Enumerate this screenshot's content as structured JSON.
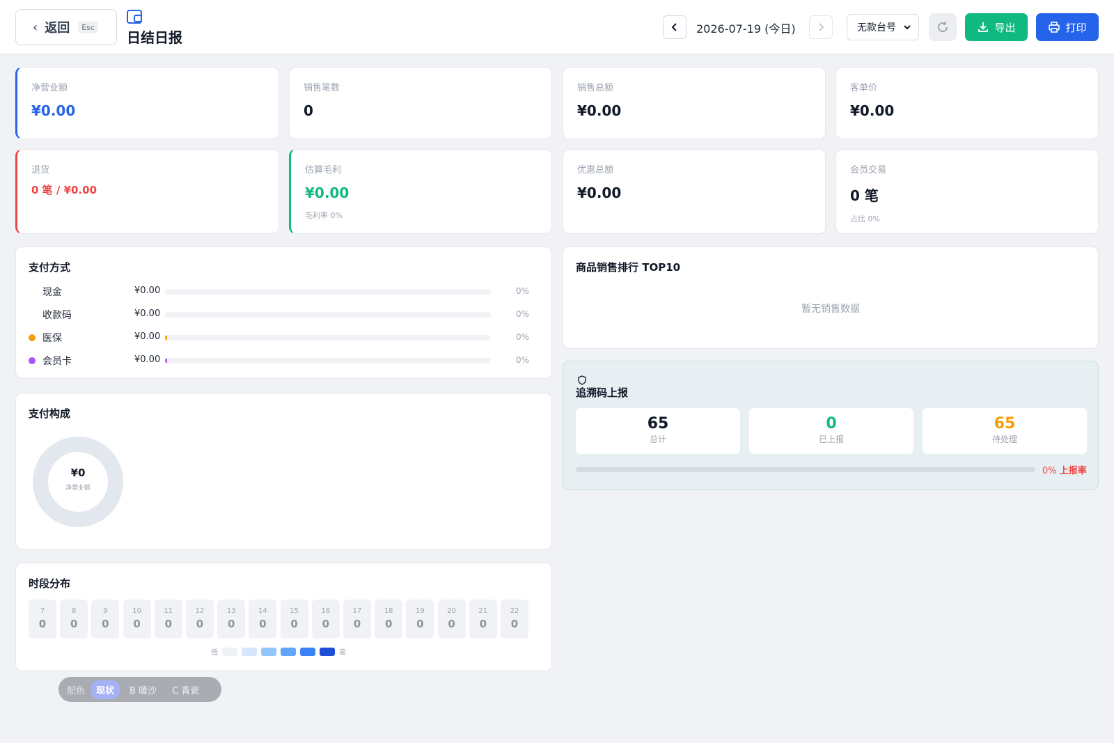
{
  "header": {
    "back_label": "返回",
    "esc_hint": "Esc",
    "title": "日结日报",
    "prev_icon": "chevron-left-icon",
    "next_icon": "chevron-right-icon",
    "date": "2026-07-19 (今日)",
    "register_value": "无款台号",
    "export_label": "导出",
    "print_label": "打印",
    "colors": {
      "export": "#10b981",
      "print": "#2563eb"
    }
  },
  "stats": [
    {
      "label": "净营业额",
      "value": "¥0.00"
    },
    {
      "label": "销售笔数",
      "value": "0"
    },
    {
      "label": "销售总额",
      "value": "¥0.00"
    },
    {
      "label": "客单价",
      "value": "¥0.00"
    },
    {
      "label": "退货",
      "value": "0 笔 / ¥0.00"
    },
    {
      "label": "估算毛利",
      "value": "¥0.00",
      "sub": "毛利率 0%"
    },
    {
      "label": "优惠总额",
      "value": "¥0.00"
    },
    {
      "label": "会员交易",
      "value": "0 笔",
      "sub": "占比 0%"
    }
  ],
  "payment": {
    "title": "支付方式",
    "rows": [
      {
        "name": "现金",
        "amount": "¥0.00",
        "pct": "0%",
        "color": ""
      },
      {
        "name": "收款码",
        "amount": "¥0.00",
        "pct": "0%",
        "color": ""
      },
      {
        "name": "医保",
        "amount": "¥0.00",
        "pct": "0%",
        "color": "#f59e0b"
      },
      {
        "name": "会员卡",
        "amount": "¥0.00",
        "pct": "0%",
        "color": "#a855f7"
      }
    ]
  },
  "ranking": {
    "title": "商品销售排行 TOP10",
    "empty": "暂无销售数据"
  },
  "composition": {
    "title": "支付构成",
    "center_value": "¥0",
    "center_label": "净营业额"
  },
  "trace": {
    "title": "追溯码上报",
    "total": "65",
    "total_label": "总计",
    "reported": "0",
    "reported_label": "已上报",
    "pending": "65",
    "pending_label": "待处理",
    "rate_value": "0%",
    "rate_label": "上报率",
    "progress": 0
  },
  "hours": {
    "title": "时段分布",
    "cells": [
      {
        "h": "7",
        "v": "0"
      },
      {
        "h": "8",
        "v": "0"
      },
      {
        "h": "9",
        "v": "0"
      },
      {
        "h": "10",
        "v": "0"
      },
      {
        "h": "11",
        "v": "0"
      },
      {
        "h": "12",
        "v": "0"
      },
      {
        "h": "13",
        "v": "0"
      },
      {
        "h": "14",
        "v": "0"
      },
      {
        "h": "15",
        "v": "0"
      },
      {
        "h": "16",
        "v": "0"
      },
      {
        "h": "17",
        "v": "0"
      },
      {
        "h": "18",
        "v": "0"
      },
      {
        "h": "19",
        "v": "0"
      },
      {
        "h": "20",
        "v": "0"
      },
      {
        "h": "21",
        "v": "0"
      },
      {
        "h": "22",
        "v": "0"
      }
    ],
    "legend_low": "低",
    "legend_high": "高",
    "legend_colors": [
      "#eef1f5",
      "#d6e6fb",
      "#93c5fd",
      "#60a5fa",
      "#3b82f6",
      "#1d4ed8"
    ]
  },
  "theme": {
    "label": "配色",
    "options": [
      "现状",
      "B 暖沙",
      "C 青瓷"
    ],
    "active": "现状"
  }
}
